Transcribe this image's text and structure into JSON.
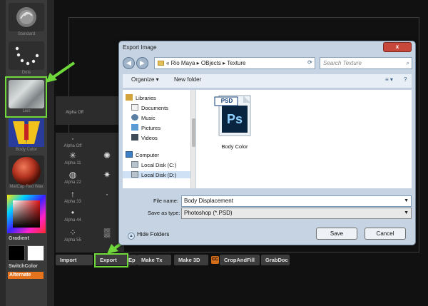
{
  "left_panel": {
    "tools": [
      {
        "label": "Standard",
        "icon": "swirl-icon"
      },
      {
        "label": "Dots",
        "icon": "dots-stroke-icon"
      },
      {
        "label": "Lies",
        "icon": "alpha-texture-icon"
      },
      {
        "label": "Body Color",
        "icon": "body-color-texture-icon"
      },
      {
        "label": "MatCap Red Wax",
        "icon": "red-sphere-material-icon"
      }
    ],
    "gradient_label": "Gradient",
    "switch_color_label": "SwitchColor",
    "alternate_label": "Alternate",
    "alternate_color": "#e5731e"
  },
  "alpha_grid": {
    "top_label": "Alpha Off",
    "cells": [
      {
        "glyph": "·",
        "label": "Alpha Off"
      },
      {
        "glyph": "",
        "label": ""
      },
      {
        "glyph": "✳",
        "label": "Alpha 11"
      },
      {
        "glyph": "✺",
        "label": ""
      },
      {
        "glyph": "◍",
        "label": "Alpha 22"
      },
      {
        "glyph": "✷",
        "label": ""
      },
      {
        "glyph": "↑",
        "label": "Alpha 33"
      },
      {
        "glyph": "·",
        "label": ""
      },
      {
        "glyph": "•",
        "label": "Alpha 44"
      },
      {
        "glyph": "",
        "label": ""
      },
      {
        "glyph": "⁘",
        "label": "Alpha 55"
      },
      {
        "glyph": "▒",
        "label": ""
      }
    ]
  },
  "bottom_bar": {
    "import": "Import",
    "export": "Export",
    "ep": "Ep",
    "make_tx": "Make Tx",
    "make_3d": "Make 3D",
    "cc": "CC",
    "crop_and_fill": "CropAndFill",
    "grab_doc": "GrabDoc"
  },
  "dialog": {
    "title": "Export Image",
    "close": "x",
    "back": "◀",
    "forward": "▶",
    "path": "« Rio Maya ▸ OBjects ▸ Texture",
    "search_placeholder": "Search Texture",
    "organize": "Organize ▾",
    "new_folder": "New folder",
    "view_toggle": "≡ ▾",
    "help": "?",
    "nav_items": [
      {
        "label": "Libraries",
        "icon": "libraries-icon"
      },
      {
        "label": "Documents",
        "icon": "documents-icon"
      },
      {
        "label": "Music",
        "icon": "music-icon"
      },
      {
        "label": "Pictures",
        "icon": "pictures-icon"
      },
      {
        "label": "Videos",
        "icon": "videos-icon"
      },
      {
        "label": "Computer",
        "icon": "computer-icon"
      },
      {
        "label": "Local Disk (C:)",
        "icon": "drive-icon"
      },
      {
        "label": "Local Disk (D:)",
        "icon": "drive-icon"
      }
    ],
    "file": {
      "name": "Body Color",
      "badge": "PSD",
      "logo": "Ps",
      "icon": "photoshop-file-icon"
    },
    "file_name_label": "File name:",
    "file_name_value": "Body Displacement",
    "save_as_label": "Save as type:",
    "save_as_value": "Photoshop (*.PSD)",
    "hide_folders": "Hide Folders",
    "save": "Save",
    "cancel": "Cancel"
  },
  "colors": {
    "highlight": "#6fd93b",
    "arrow": "#6fd93b",
    "dialog_chrome": "#c5d3e2",
    "close_button": "#c7473a"
  }
}
